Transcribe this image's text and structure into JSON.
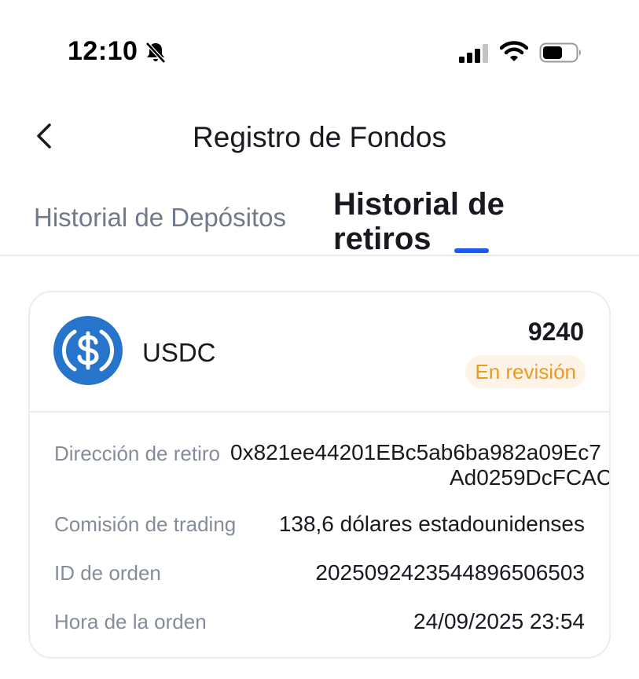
{
  "status_bar": {
    "time": "12:10",
    "icons": [
      "bell-slash-icon",
      "cellular-signal-icon",
      "wifi-icon",
      "battery-icon"
    ]
  },
  "header": {
    "title": "Registro de Fondos",
    "back_icon": "chevron-left-icon"
  },
  "tabs": [
    {
      "label": "Historial de Depósitos",
      "active": false
    },
    {
      "label": "Historial de retiros",
      "active": true
    }
  ],
  "colors": {
    "accent": "#1a5af5",
    "badge_text": "#ef9a1f",
    "badge_bg": "#fdf3e7",
    "usdc_blue": "#2775ca",
    "label_gray": "#858c99"
  },
  "record": {
    "coin": "USDC",
    "coin_icon": "usdc-dollar-icon",
    "amount": "9240",
    "status": "En revisión",
    "rows": {
      "address": {
        "label": "Dirección de retiro",
        "value_line1": "0x821ee44201EBc5ab6ba982a09Ec7",
        "value_line2": "Ad0259DcFCAC"
      },
      "fee": {
        "label": "Comisión de trading",
        "value": "138,6 dólares estadounidenses"
      },
      "order_id": {
        "label": "ID de orden",
        "value": "2025092423544896506503"
      },
      "order_time": {
        "label": "Hora de la orden",
        "value": "24/09/2025 23:54"
      }
    }
  }
}
